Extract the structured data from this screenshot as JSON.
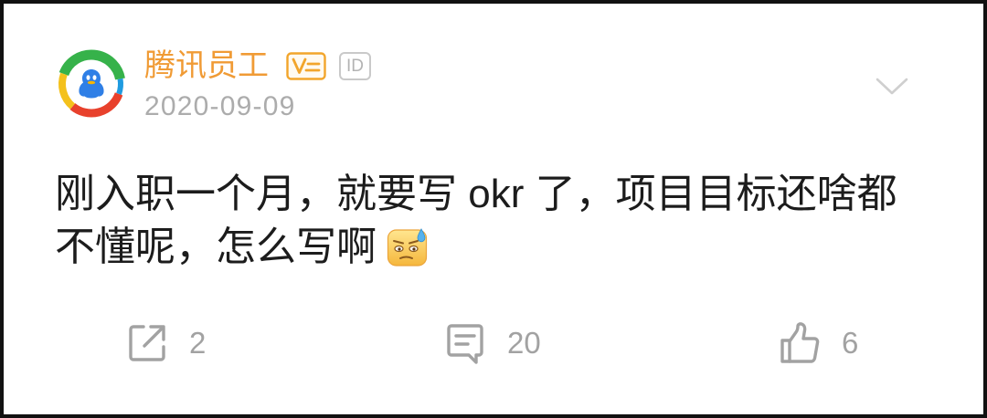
{
  "theme": {
    "username_color": "#f09b35",
    "badge_color": "#f2a52b",
    "text_color": "#1c1c1c",
    "meta_color": "#acacac",
    "icon_color": "#a2a2a2",
    "chevron_color": "#cfcfcf",
    "border_color": "#111111"
  },
  "post": {
    "author": {
      "name": "腾讯员工",
      "avatar": "tencent-logo-icon",
      "verified_badge": "verified-v-icon",
      "id_badge": "ID"
    },
    "date": "2020-09-09",
    "menu_icon": "chevron-down-icon",
    "content_lines": [
      "刚入职一个月，就要写 okr 了，项目目标还啥都",
      "不懂呢，怎么写啊"
    ],
    "emoji": "sweat-emoji-icon"
  },
  "actions": [
    {
      "icon": "share-icon",
      "count": "2"
    },
    {
      "icon": "comment-icon",
      "count": "20"
    },
    {
      "icon": "like-icon",
      "count": "6"
    }
  ]
}
